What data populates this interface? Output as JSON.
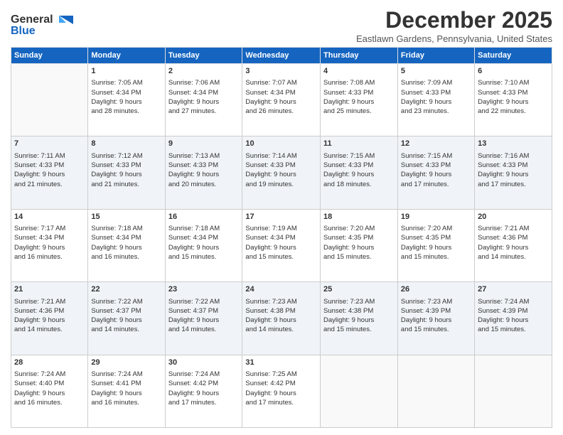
{
  "logo": {
    "line1": "General",
    "line2": "Blue"
  },
  "title": "December 2025",
  "location": "Eastlawn Gardens, Pennsylvania, United States",
  "weekdays": [
    "Sunday",
    "Monday",
    "Tuesday",
    "Wednesday",
    "Thursday",
    "Friday",
    "Saturday"
  ],
  "weeks": [
    [
      {
        "day": "",
        "info": ""
      },
      {
        "day": "1",
        "info": "Sunrise: 7:05 AM\nSunset: 4:34 PM\nDaylight: 9 hours\nand 28 minutes."
      },
      {
        "day": "2",
        "info": "Sunrise: 7:06 AM\nSunset: 4:34 PM\nDaylight: 9 hours\nand 27 minutes."
      },
      {
        "day": "3",
        "info": "Sunrise: 7:07 AM\nSunset: 4:34 PM\nDaylight: 9 hours\nand 26 minutes."
      },
      {
        "day": "4",
        "info": "Sunrise: 7:08 AM\nSunset: 4:33 PM\nDaylight: 9 hours\nand 25 minutes."
      },
      {
        "day": "5",
        "info": "Sunrise: 7:09 AM\nSunset: 4:33 PM\nDaylight: 9 hours\nand 23 minutes."
      },
      {
        "day": "6",
        "info": "Sunrise: 7:10 AM\nSunset: 4:33 PM\nDaylight: 9 hours\nand 22 minutes."
      }
    ],
    [
      {
        "day": "7",
        "info": "Sunrise: 7:11 AM\nSunset: 4:33 PM\nDaylight: 9 hours\nand 21 minutes."
      },
      {
        "day": "8",
        "info": "Sunrise: 7:12 AM\nSunset: 4:33 PM\nDaylight: 9 hours\nand 21 minutes."
      },
      {
        "day": "9",
        "info": "Sunrise: 7:13 AM\nSunset: 4:33 PM\nDaylight: 9 hours\nand 20 minutes."
      },
      {
        "day": "10",
        "info": "Sunrise: 7:14 AM\nSunset: 4:33 PM\nDaylight: 9 hours\nand 19 minutes."
      },
      {
        "day": "11",
        "info": "Sunrise: 7:15 AM\nSunset: 4:33 PM\nDaylight: 9 hours\nand 18 minutes."
      },
      {
        "day": "12",
        "info": "Sunrise: 7:15 AM\nSunset: 4:33 PM\nDaylight: 9 hours\nand 17 minutes."
      },
      {
        "day": "13",
        "info": "Sunrise: 7:16 AM\nSunset: 4:33 PM\nDaylight: 9 hours\nand 17 minutes."
      }
    ],
    [
      {
        "day": "14",
        "info": "Sunrise: 7:17 AM\nSunset: 4:34 PM\nDaylight: 9 hours\nand 16 minutes."
      },
      {
        "day": "15",
        "info": "Sunrise: 7:18 AM\nSunset: 4:34 PM\nDaylight: 9 hours\nand 16 minutes."
      },
      {
        "day": "16",
        "info": "Sunrise: 7:18 AM\nSunset: 4:34 PM\nDaylight: 9 hours\nand 15 minutes."
      },
      {
        "day": "17",
        "info": "Sunrise: 7:19 AM\nSunset: 4:34 PM\nDaylight: 9 hours\nand 15 minutes."
      },
      {
        "day": "18",
        "info": "Sunrise: 7:20 AM\nSunset: 4:35 PM\nDaylight: 9 hours\nand 15 minutes."
      },
      {
        "day": "19",
        "info": "Sunrise: 7:20 AM\nSunset: 4:35 PM\nDaylight: 9 hours\nand 15 minutes."
      },
      {
        "day": "20",
        "info": "Sunrise: 7:21 AM\nSunset: 4:36 PM\nDaylight: 9 hours\nand 14 minutes."
      }
    ],
    [
      {
        "day": "21",
        "info": "Sunrise: 7:21 AM\nSunset: 4:36 PM\nDaylight: 9 hours\nand 14 minutes."
      },
      {
        "day": "22",
        "info": "Sunrise: 7:22 AM\nSunset: 4:37 PM\nDaylight: 9 hours\nand 14 minutes."
      },
      {
        "day": "23",
        "info": "Sunrise: 7:22 AM\nSunset: 4:37 PM\nDaylight: 9 hours\nand 14 minutes."
      },
      {
        "day": "24",
        "info": "Sunrise: 7:23 AM\nSunset: 4:38 PM\nDaylight: 9 hours\nand 14 minutes."
      },
      {
        "day": "25",
        "info": "Sunrise: 7:23 AM\nSunset: 4:38 PM\nDaylight: 9 hours\nand 15 minutes."
      },
      {
        "day": "26",
        "info": "Sunrise: 7:23 AM\nSunset: 4:39 PM\nDaylight: 9 hours\nand 15 minutes."
      },
      {
        "day": "27",
        "info": "Sunrise: 7:24 AM\nSunset: 4:39 PM\nDaylight: 9 hours\nand 15 minutes."
      }
    ],
    [
      {
        "day": "28",
        "info": "Sunrise: 7:24 AM\nSunset: 4:40 PM\nDaylight: 9 hours\nand 16 minutes."
      },
      {
        "day": "29",
        "info": "Sunrise: 7:24 AM\nSunset: 4:41 PM\nDaylight: 9 hours\nand 16 minutes."
      },
      {
        "day": "30",
        "info": "Sunrise: 7:24 AM\nSunset: 4:42 PM\nDaylight: 9 hours\nand 17 minutes."
      },
      {
        "day": "31",
        "info": "Sunrise: 7:25 AM\nSunset: 4:42 PM\nDaylight: 9 hours\nand 17 minutes."
      },
      {
        "day": "",
        "info": ""
      },
      {
        "day": "",
        "info": ""
      },
      {
        "day": "",
        "info": ""
      }
    ]
  ]
}
